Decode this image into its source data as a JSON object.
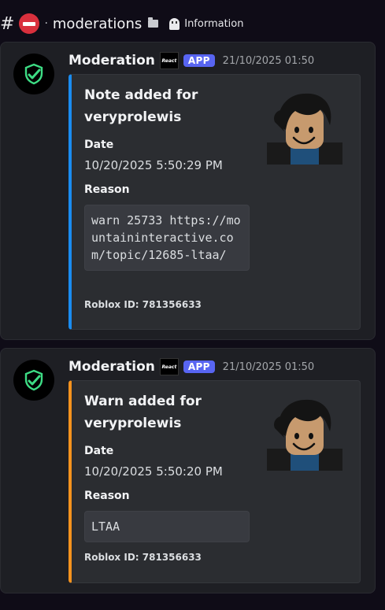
{
  "channel": {
    "hash": "#",
    "separator": "·",
    "name": "moderations",
    "thread": "Information"
  },
  "messages": [
    {
      "author": "Moderation",
      "server_tag": "React",
      "app_tag": "APP",
      "timestamp": "21/10/2025 01:50",
      "embed": {
        "accent_color": "#1a8cf0",
        "title": "Note added for veryprolewis",
        "date_label": "Date",
        "date_value": "10/20/2025 5:50:29 PM",
        "reason_label": "Reason",
        "reason_value": "warn 25733 https://mountaininteractive.com/topic/12685-ltaa/",
        "footer": "Roblox ID: 781356633"
      }
    },
    {
      "author": "Moderation",
      "server_tag": "React",
      "app_tag": "APP",
      "timestamp": "21/10/2025 01:50",
      "embed": {
        "accent_color": "#f5921e",
        "title": "Warn added for veryprolewis",
        "date_label": "Date",
        "date_value": "10/20/2025 5:50:20 PM",
        "reason_label": "Reason",
        "reason_value": "LTAA",
        "footer": "Roblox ID: 781356633"
      }
    }
  ],
  "colors": {
    "background": "#0f0c17",
    "app_tag": "#5865f2",
    "avatar_shield": "#3ddc84"
  },
  "icons": [
    "no-entry-icon",
    "folder-icon",
    "ghost-icon",
    "shield-check-icon",
    "roblox-avatar-icon"
  ]
}
